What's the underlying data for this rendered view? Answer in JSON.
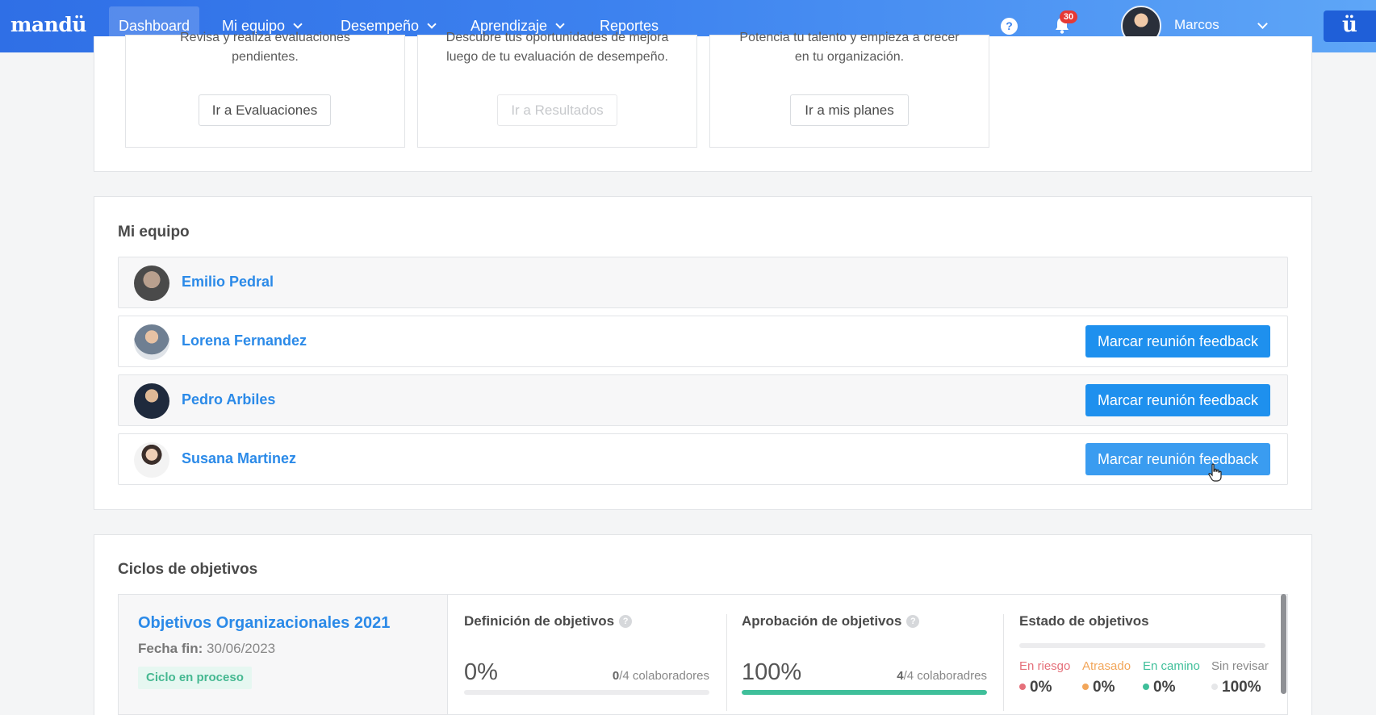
{
  "nav": {
    "logo": "mandü",
    "items": [
      {
        "label": "Dashboard",
        "active": true,
        "dropdown": false
      },
      {
        "label": "Mi equipo",
        "active": false,
        "dropdown": true
      },
      {
        "label": "Desempeño",
        "active": false,
        "dropdown": true
      },
      {
        "label": "Aprendizaje",
        "active": false,
        "dropdown": true
      },
      {
        "label": "Reportes",
        "active": false,
        "dropdown": false
      }
    ],
    "help_glyph": "?",
    "notifications_count": "30",
    "user_name": "Marcos",
    "brand_tile": "ü"
  },
  "promo_cards": [
    {
      "text_line1": "Revisa y realiza evaluaciones",
      "text_line2": "pendientes.",
      "button": "Ir a Evaluaciones",
      "disabled": false
    },
    {
      "text_line1": "Descubre tus oportunidades de mejora",
      "text_line2": "luego de tu evaluación de desempeño.",
      "button": "Ir a Resultados",
      "disabled": true
    },
    {
      "text_line1": "Potencia tu talento y empieza a crecer",
      "text_line2": "en tu organización.",
      "button": "Ir a mis planes",
      "disabled": false
    }
  ],
  "team": {
    "title": "Mi equipo",
    "members": [
      {
        "name": "Emilio Pedral",
        "button": null
      },
      {
        "name": "Lorena Fernandez",
        "button": "Marcar reunión feedback"
      },
      {
        "name": "Pedro Arbiles",
        "button": "Marcar reunión feedback"
      },
      {
        "name": "Susana Martinez",
        "button": "Marcar reunión feedback"
      }
    ]
  },
  "cycles": {
    "title": "Ciclos de objetivos",
    "cycle": {
      "name": "Objetivos Organizacionales 2021",
      "date_label": "Fecha fin:",
      "date_value": "30/06/2023",
      "status": "Ciclo en proceso"
    },
    "definition": {
      "title": "Definición de objetivos",
      "percent": "0%",
      "done": "0",
      "total_text": "/4 colaboradores",
      "progress": 0
    },
    "approval": {
      "title": "Aprobación de objetivos",
      "percent": "100%",
      "done": "4",
      "total_text": "/4 colaboradres",
      "progress": 1
    },
    "status": {
      "title": "Estado de objetivos",
      "items": [
        {
          "label": "En riesgo",
          "value": "0%",
          "color": "#e5707a"
        },
        {
          "label": "Atrasado",
          "value": "0%",
          "color": "#f2a65a"
        },
        {
          "label": "En camino",
          "value": "0%",
          "color": "#3fbf9a"
        },
        {
          "label": "Sin revisar",
          "value": "100%",
          "color": "#d9dadc"
        }
      ]
    }
  },
  "colors": {
    "nav_start": "#2f6fe6",
    "nav_end": "#5ea6f7",
    "primary_button": "#1e90ee",
    "link": "#2b8ae8"
  }
}
